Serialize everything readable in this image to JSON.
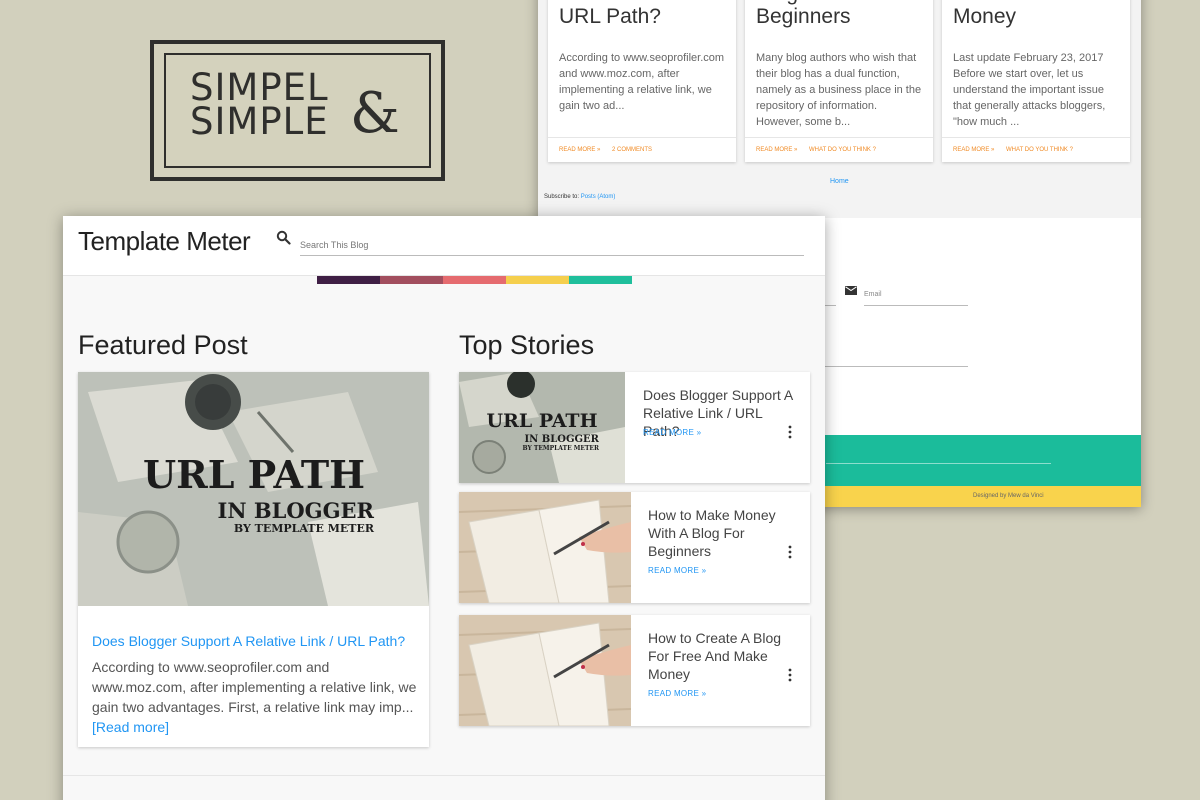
{
  "logo": {
    "line1": "SIMPEL",
    "line2": "SIMPLE",
    "ampersand": "&"
  },
  "back_window": {
    "cards": [
      {
        "title": "Relative Link /\nURL Path?",
        "text": "According to www.seoprofiler.com and www.moz.com, after implementing a relative link, we gain two ad...",
        "links": [
          "READ MORE »",
          "2 COMMENTS"
        ]
      },
      {
        "title": "Blog For\nBeginners",
        "text": "Many blog authors who wish that their blog has a dual function, namely as a business place in the repository of information. However, some b...",
        "links": [
          "READ MORE »",
          "WHAT DO YOU THINK ?"
        ]
      },
      {
        "title": "And Make\nMoney",
        "text": "Last update February 23, 2017 Before we start over, let us understand the important issue that generally attacks bloggers, \"how much ...",
        "links": [
          "READ MORE »",
          "WHAT DO YOU THINK ?"
        ]
      }
    ],
    "home_link": "Home",
    "subscribe_label": "Subscribe to:",
    "subscribe_link": "Posts (Atom)",
    "email_placeholder": "Email",
    "credit": "Designed by Mew da Vinci"
  },
  "front_window": {
    "site_title": "Template Meter",
    "search": {
      "placeholder": "Search This Blog",
      "value": ""
    },
    "stripe_colors": [
      "#3f1f45",
      "#a24e5e",
      "#e56b6f",
      "#f5cf4d",
      "#1fbf9c"
    ],
    "featured": {
      "heading": "Featured Post",
      "image_title_1": "URL PATH",
      "image_title_2": "IN BLOGGER",
      "image_subtitle": "BY TEMPLATE METER",
      "post_title": "Does Blogger Support A Relative Link / URL Path?",
      "excerpt": "According to www.seoprofiler.com and www.moz.com, after implementing a relative link, we gain two advantages. First, a relative link may imp...",
      "read_more": "[Read more]"
    },
    "top_stories": {
      "heading": "Top Stories",
      "items": [
        {
          "title": "Does Blogger Support A Relative Link / URL Path?",
          "read_more": "READ MORE »",
          "image": "url-path-thumbnail",
          "image_title_1": "URL PATH",
          "image_title_2": "IN BLOGGER",
          "image_subtitle": "BY TEMPLATE METER"
        },
        {
          "title": "How to Make Money With A Blog For Beginners",
          "read_more": "READ MORE »",
          "image": "notebook-writing-thumbnail"
        },
        {
          "title": "How to Create A Blog For Free And Make Money",
          "read_more": "READ MORE »",
          "image": "notebook-writing-thumbnail"
        }
      ]
    }
  },
  "colors": {
    "background": "#d2d0bd",
    "link": "#2196f3",
    "accent_orange": "#f08a24",
    "teal": "#1bbc9b",
    "yellow": "#f9d34c"
  },
  "icons": [
    "search-icon",
    "kebab-menu-icon",
    "email-icon"
  ]
}
